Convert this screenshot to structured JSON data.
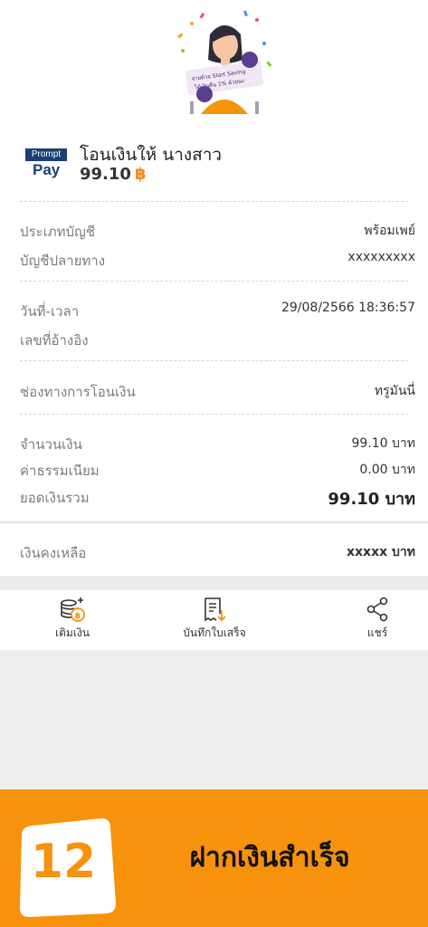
{
  "header": {
    "promo_text_1": "จ่ายด้วย Start Saving",
    "promo_text_2": "ได้เงินคืน 1% ด้วยนะ",
    "logo_top": "Prompt",
    "logo_bottom": "Pay",
    "title": "โอนเงินให้ นางสาว",
    "amount": "99.10",
    "currency_symbol": "฿"
  },
  "details": {
    "account_type": {
      "label": "ประเภทบัญชี",
      "value": "พร้อมเพย์"
    },
    "destination_account": {
      "label": "บัญชีปลายทาง",
      "value": "xxxxxxxxx"
    },
    "datetime": {
      "label": "วันที่-เวลา",
      "value": "29/08/2566 18:36:57"
    },
    "reference": {
      "label": "เลขที่อ้างอิง",
      "value": ""
    },
    "channel": {
      "label": "ช่องทางการโอนเงิน",
      "value": "ทรูมันนี่"
    },
    "amount": {
      "label": "จำนวนเงิน",
      "value": "99.10 บาท"
    },
    "fee": {
      "label": "ค่าธรรมเนียม",
      "value": "0.00 บาท"
    },
    "total": {
      "label": "ยอดเงินรวม",
      "value": "99.10 บาท"
    },
    "balance": {
      "label": "เงินคงเหลือ",
      "value": "xxxxx บาท"
    }
  },
  "actions": {
    "top_up": "เติมเงิน",
    "save_slip": "บันทึกใบเสร็จ",
    "share": "แชร์"
  },
  "footer": {
    "step_number": "12",
    "caption": "ฝากเงินสำเร็จ"
  },
  "colors": {
    "accent": "#f7920c",
    "brand": "#1b3f73"
  }
}
